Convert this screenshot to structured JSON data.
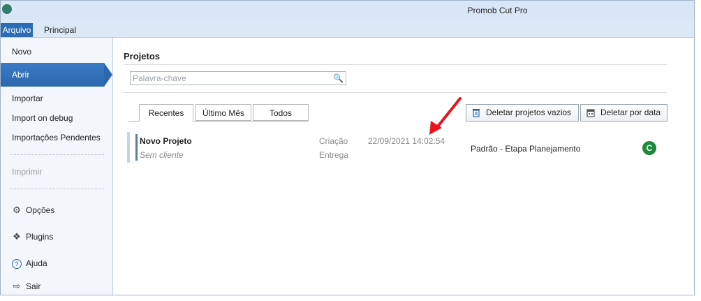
{
  "window": {
    "title": "Promob Cut Pro"
  },
  "ribbon": {
    "tabs": [
      "Arquivo",
      "Principal"
    ]
  },
  "sidebar": {
    "items": [
      "Novo",
      "Abrir",
      "Importar",
      "Import on debug",
      "Importações Pendentes",
      "Imprimir",
      "Opções",
      "Plugins",
      "Ajuda",
      "Sair"
    ]
  },
  "main": {
    "heading": "Projetos",
    "search": {
      "placeholder": "Palavra-chave"
    },
    "tabs": [
      "Recentes",
      "Último Mês",
      "Todos"
    ],
    "buttons": {
      "delete_empty": "Deletar projetos vazios",
      "delete_by_date": "Deletar por data"
    },
    "project": {
      "name": "Novo Projeto",
      "client": "Sem cliente",
      "label_creation": "Criação",
      "label_delivery": "Entrega",
      "created": "22/09/2021 14:02:54",
      "stage": "Padrão - Etapa Planejamento",
      "status_letter": "C"
    }
  },
  "colors": {
    "accent": "#2b6cb5",
    "status": "#1c8a3a",
    "annotation": "#e8141e"
  }
}
